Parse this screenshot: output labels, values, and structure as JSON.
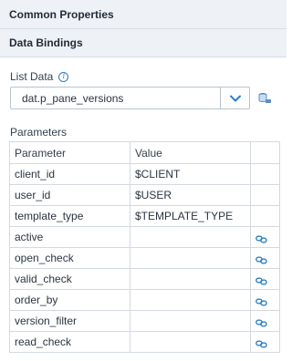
{
  "sections": {
    "common_properties": "Common Properties",
    "data_bindings": "Data Bindings"
  },
  "list_data": {
    "label": "List Data",
    "selected_value": "dat.p_pane_versions"
  },
  "parameters": {
    "label": "Parameters",
    "columns": [
      "Parameter",
      "Value",
      ""
    ],
    "rows": [
      {
        "name": "client_id",
        "value": "$CLIENT",
        "linked": false
      },
      {
        "name": "user_id",
        "value": "$USER",
        "linked": false
      },
      {
        "name": "template_type",
        "value": "$TEMPLATE_TYPE",
        "linked": false
      },
      {
        "name": "active",
        "value": "",
        "linked": true
      },
      {
        "name": "open_check",
        "value": "",
        "linked": true
      },
      {
        "name": "valid_check",
        "value": "",
        "linked": true
      },
      {
        "name": "order_by",
        "value": "",
        "linked": true
      },
      {
        "name": "version_filter",
        "value": "",
        "linked": true
      },
      {
        "name": "read_check",
        "value": "",
        "linked": true
      }
    ]
  },
  "icons": {
    "info": "info-icon",
    "dropdown": "chevron-down-icon",
    "side_action": "database-icon",
    "bind": "link-icon"
  },
  "colors": {
    "accent": "#2b7fc4",
    "header_bg": "#eef2f6",
    "border": "#d3d9e0"
  }
}
